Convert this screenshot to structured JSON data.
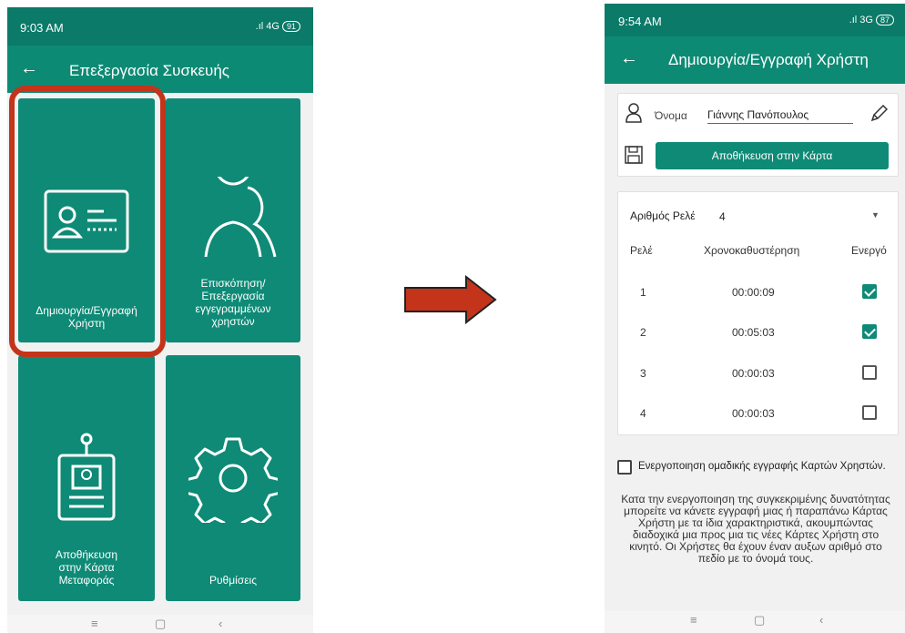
{
  "left_screen": {
    "status": {
      "time": "9:03 AM",
      "network": "4G",
      "battery": "91"
    },
    "appbar": {
      "back": "←",
      "title": "Επεξεργασία Συσκευής"
    },
    "tiles": [
      {
        "label": "Δημιουργία/Εγγραφή\nΧρήστη",
        "icon": "id-card-icon"
      },
      {
        "label": "Επισκόπηση/\nΕπεξεργασία\nεγγεγραμμένων\nχρηστών",
        "icon": "users-icon"
      },
      {
        "label": "Αποθήκευση\nστην Κάρτα\nΜεταφοράς",
        "icon": "badge-icon"
      },
      {
        "label": "Ρυθμίσεις",
        "icon": "gear-icon"
      }
    ],
    "nav": {
      "menu": "≡",
      "home": "▢",
      "back": "‹"
    }
  },
  "arrow": {
    "color": "#c4341a"
  },
  "right_screen": {
    "status": {
      "time": "9:54 AM",
      "network": "3G",
      "battery": "87"
    },
    "appbar": {
      "back": "←",
      "title": "Δημιουργία/Εγγραφή Χρήστη"
    },
    "name_field": {
      "label": "Όνομα",
      "value": "Γιάννης Πανόπουλος"
    },
    "save_button": "Αποθήκευση στην Κάρτα",
    "relay_count": {
      "label": "Αριθμός Ρελέ",
      "value": "4"
    },
    "table": {
      "headers": [
        "Ρελέ",
        "Χρονοκαθυστέρηση",
        "Ενεργό"
      ],
      "rows": [
        {
          "relay": "1",
          "delay": "00:00:09",
          "active": true
        },
        {
          "relay": "2",
          "delay": "00:05:03",
          "active": true
        },
        {
          "relay": "3",
          "delay": "00:00:03",
          "active": false
        },
        {
          "relay": "4",
          "delay": "00:00:03",
          "active": false
        }
      ]
    },
    "group_option": "Ενεργοποιηση ομαδικής εγγραφής Καρτών Χρηστών.",
    "description": "Κατα την ενεργοποιηση της συγκεκριμένης δυνατότητας μπορείτε να κάνετε εγγραφή μιας ή παραπάνω Κάρτας Χρήστη με τα ίδια χαρακτηριστικά, ακουμπώντας διαδοχικά μια προς μια τις νέες Κάρτες Χρήστη στο κινητό. Οι Χρήστες θα έχουν έναν αυξων αριθμό στο πεδίο με το όνομά τους.",
    "nav": {
      "menu": "≡",
      "home": "▢",
      "back": "‹"
    }
  }
}
